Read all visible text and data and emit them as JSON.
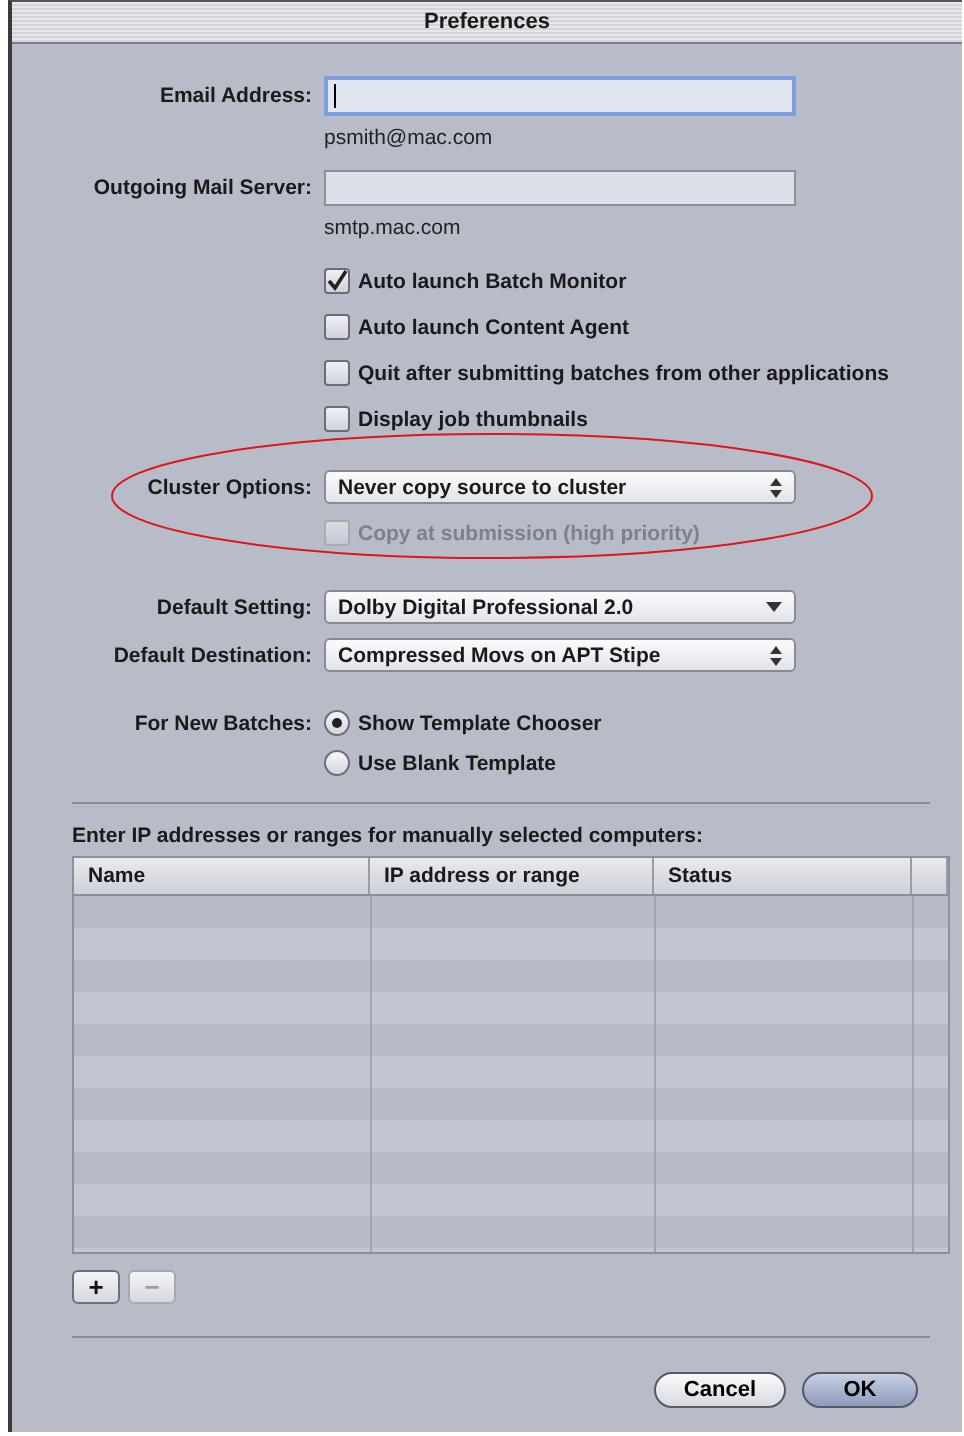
{
  "window": {
    "title": "Preferences"
  },
  "fields": [
    {
      "label": "Email Address:",
      "focused": true,
      "hint": "psmith@mac.com"
    },
    {
      "label": "Outgoing Mail Server:",
      "focused": false,
      "hint": "smtp.mac.com"
    }
  ],
  "checkboxes": [
    {
      "label": "Auto launch Batch Monitor",
      "checked": true,
      "disabled": false
    },
    {
      "label": "Auto launch Content Agent",
      "checked": false,
      "disabled": false
    },
    {
      "label": "Quit after submitting batches from other applications",
      "checked": false,
      "disabled": false
    },
    {
      "label": "Display job thumbnails",
      "checked": false,
      "disabled": false
    }
  ],
  "cluster": {
    "label": "Cluster Options:",
    "value": "Never copy source to cluster",
    "kind": "stepper",
    "option": {
      "label": "Copy at submission (high priority)",
      "checked": false,
      "disabled": true
    },
    "highlighted": true
  },
  "popups": [
    {
      "label": "Default Setting:",
      "value": "Dolby Digital Professional 2.0",
      "kind": "dropdown"
    },
    {
      "label": "Default Destination:",
      "value": "Compressed Movs on APT Stipe",
      "kind": "stepper"
    }
  ],
  "new_batches": {
    "label": "For New Batches:",
    "options": [
      {
        "label": "Show Template Chooser",
        "selected": true
      },
      {
        "label": "Use Blank Template",
        "selected": false
      }
    ]
  },
  "computers": {
    "caption": "Enter IP addresses or ranges for manually selected computers:",
    "columns": [
      "Name",
      "IP address or range",
      "Status",
      ""
    ],
    "add_button": {
      "label": "+",
      "disabled": false
    },
    "remove_button": {
      "label": "−",
      "disabled": true
    }
  },
  "buttons": [
    {
      "label": "Cancel",
      "default": false
    },
    {
      "label": "OK",
      "default": true
    }
  ]
}
